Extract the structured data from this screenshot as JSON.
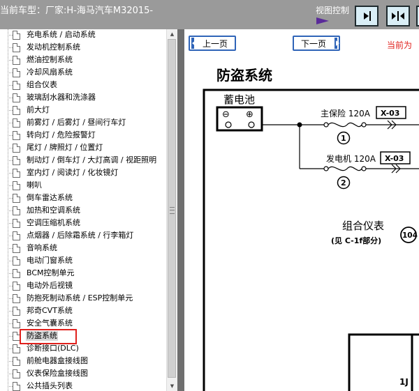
{
  "window": {
    "title": "当前车型：厂家:H-海马汽车M32015-",
    "view_control_label": "视图控制"
  },
  "sidebar": {
    "items": [
      "充电系统 / 启动系统",
      "发动机控制系统",
      "燃油控制系统",
      "冷却风扇系统",
      "组合仪表",
      "玻璃刮水器和洗涤器",
      "前大灯",
      "前雾灯 / 后雾灯 / 昼间行车灯",
      "转向灯 / 危险报警灯",
      "尾灯 / 牌照灯 / 位置灯",
      "制动灯 / 倒车灯 / 大灯高调 / 视距照明",
      "室内灯 / 阅读灯 / 化妆镜灯",
      "喇叭",
      "倒车雷达系统",
      "加热和空调系统",
      "空调压缩机系统",
      "点烟器 / 后除霜系统 / 行李箱灯",
      "音响系统",
      "电动门窗系统",
      "BCM控制单元",
      "电动外后视镜",
      "防抱死制动系统 / ESP控制单元",
      "邦奇CVT系统",
      "安全气囊系统",
      "防盗系统",
      "诊断接口(DLC)",
      "前舱电器盒接线图",
      "仪表保险盒接线图",
      "公共插头列表"
    ],
    "selected_index": 24
  },
  "toolbar": {
    "prev_label": "上一页",
    "next_label": "下一页",
    "current_label": "当前为"
  },
  "page": {
    "title": "防盗系统"
  },
  "diagram": {
    "battery_label": "蓄电池",
    "minus": "⊖",
    "plus": "⊕",
    "fuse1_label": "主保险 120A",
    "fuse1_conn": "X-03",
    "fuse1_num": "1",
    "fuse2_label": "发电机 120A",
    "fuse2_conn": "X-03",
    "fuse2_num": "2",
    "cluster_label": "组合仪表",
    "cluster_ref": "(见 C-1f部分)",
    "cluster_num": "104",
    "box_label": "1J"
  },
  "colors": {
    "titlebar": "#9a9a9a",
    "accent_blue": "#2f64b8",
    "highlight_red": "#e0201c",
    "splitter": "#6f6f6f",
    "arrow_purple": "#5a2a9a"
  },
  "icons": {
    "toolbar_1": "panel-left-arrow-icon",
    "toolbar_2": "split-panels-icon",
    "view_arrow": "triangle-right-icon"
  }
}
